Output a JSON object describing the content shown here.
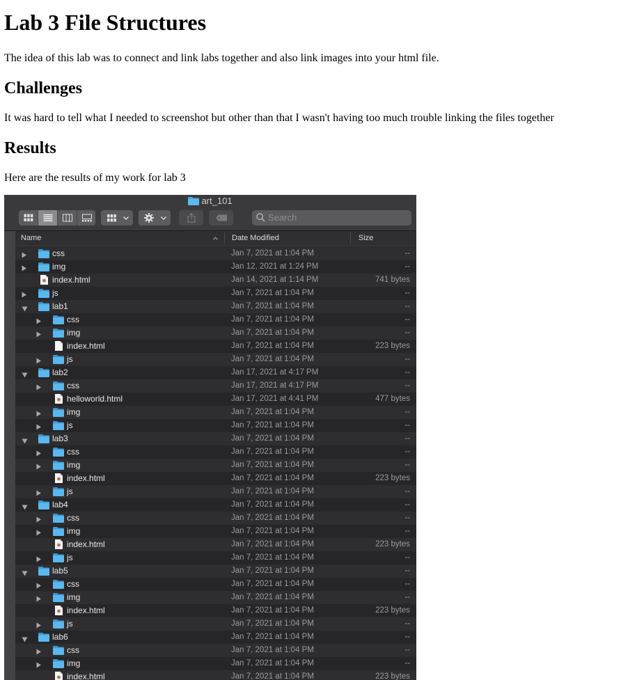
{
  "page": {
    "title": "Lab 3 File Structures",
    "intro": "The idea of this lab was to connect and link labs together and also link images into your html file.",
    "challenges_heading": "Challenges",
    "challenges_text": "It was hard to tell what I needed to screenshot but other than that I wasn't having too much trouble linking the files together",
    "results_heading": "Results",
    "results_text": "Here are the results of my work for lab 3"
  },
  "finder": {
    "window_title": "art_101",
    "search_placeholder": "Search",
    "columns": {
      "name": "Name",
      "date": "Date Modified",
      "size": "Size"
    },
    "colors": {
      "folder": "#4aa8e0",
      "background": "#262626",
      "row_alt": "#2e2e30",
      "text": "#e8e8e8",
      "muted": "#9a9a9a"
    },
    "rows": [
      {
        "name": "css",
        "kind": "folder",
        "depth": 0,
        "expanded": false,
        "date": "Jan 7, 2021 at 1:04 PM",
        "size": "--"
      },
      {
        "name": "img",
        "kind": "folder",
        "depth": 0,
        "expanded": false,
        "date": "Jan 12, 2021 at 1:24 PM",
        "size": "--"
      },
      {
        "name": "index.html",
        "kind": "html",
        "depth": 0,
        "date": "Jan 14, 2021 at 1:14 PM",
        "size": "741 bytes"
      },
      {
        "name": "js",
        "kind": "folder",
        "depth": 0,
        "expanded": false,
        "date": "Jan 7, 2021 at 1:04 PM",
        "size": "--"
      },
      {
        "name": "lab1",
        "kind": "folder",
        "depth": 0,
        "expanded": true,
        "date": "Jan 7, 2021 at 1:04 PM",
        "size": "--"
      },
      {
        "name": "css",
        "kind": "folder",
        "depth": 1,
        "expanded": false,
        "date": "Jan 7, 2021 at 1:04 PM",
        "size": "--"
      },
      {
        "name": "img",
        "kind": "folder",
        "depth": 1,
        "expanded": false,
        "date": "Jan 7, 2021 at 1:04 PM",
        "size": "--"
      },
      {
        "name": "index.html",
        "kind": "file",
        "depth": 1,
        "date": "Jan 7, 2021 at 1:04 PM",
        "size": "223 bytes"
      },
      {
        "name": "js",
        "kind": "folder",
        "depth": 1,
        "expanded": false,
        "date": "Jan 7, 2021 at 1:04 PM",
        "size": "--"
      },
      {
        "name": "lab2",
        "kind": "folder",
        "depth": 0,
        "expanded": true,
        "date": "Jan 17, 2021 at 4:17 PM",
        "size": "--"
      },
      {
        "name": "css",
        "kind": "folder",
        "depth": 1,
        "expanded": false,
        "date": "Jan 17, 2021 at 4:17 PM",
        "size": "--"
      },
      {
        "name": "helloworld.html",
        "kind": "html",
        "depth": 1,
        "date": "Jan 17, 2021 at 4:41 PM",
        "size": "477 bytes"
      },
      {
        "name": "img",
        "kind": "folder",
        "depth": 1,
        "expanded": false,
        "date": "Jan 7, 2021 at 1:04 PM",
        "size": "--"
      },
      {
        "name": "js",
        "kind": "folder",
        "depth": 1,
        "expanded": false,
        "date": "Jan 7, 2021 at 1:04 PM",
        "size": "--"
      },
      {
        "name": "lab3",
        "kind": "folder",
        "depth": 0,
        "expanded": true,
        "date": "Jan 7, 2021 at 1:04 PM",
        "size": "--"
      },
      {
        "name": "css",
        "kind": "folder",
        "depth": 1,
        "expanded": false,
        "date": "Jan 7, 2021 at 1:04 PM",
        "size": "--"
      },
      {
        "name": "img",
        "kind": "folder",
        "depth": 1,
        "expanded": false,
        "date": "Jan 7, 2021 at 1:04 PM",
        "size": "--"
      },
      {
        "name": "index.html",
        "kind": "html",
        "depth": 1,
        "date": "Jan 7, 2021 at 1:04 PM",
        "size": "223 bytes"
      },
      {
        "name": "js",
        "kind": "folder",
        "depth": 1,
        "expanded": false,
        "date": "Jan 7, 2021 at 1:04 PM",
        "size": "--"
      },
      {
        "name": "lab4",
        "kind": "folder",
        "depth": 0,
        "expanded": true,
        "date": "Jan 7, 2021 at 1:04 PM",
        "size": "--"
      },
      {
        "name": "css",
        "kind": "folder",
        "depth": 1,
        "expanded": false,
        "date": "Jan 7, 2021 at 1:04 PM",
        "size": "--"
      },
      {
        "name": "img",
        "kind": "folder",
        "depth": 1,
        "expanded": false,
        "date": "Jan 7, 2021 at 1:04 PM",
        "size": "--"
      },
      {
        "name": "index.html",
        "kind": "html",
        "depth": 1,
        "date": "Jan 7, 2021 at 1:04 PM",
        "size": "223 bytes"
      },
      {
        "name": "js",
        "kind": "folder",
        "depth": 1,
        "expanded": false,
        "date": "Jan 7, 2021 at 1:04 PM",
        "size": "--"
      },
      {
        "name": "lab5",
        "kind": "folder",
        "depth": 0,
        "expanded": true,
        "date": "Jan 7, 2021 at 1:04 PM",
        "size": "--"
      },
      {
        "name": "css",
        "kind": "folder",
        "depth": 1,
        "expanded": false,
        "date": "Jan 7, 2021 at 1:04 PM",
        "size": "--"
      },
      {
        "name": "img",
        "kind": "folder",
        "depth": 1,
        "expanded": false,
        "date": "Jan 7, 2021 at 1:04 PM",
        "size": "--"
      },
      {
        "name": "index.html",
        "kind": "html",
        "depth": 1,
        "date": "Jan 7, 2021 at 1:04 PM",
        "size": "223 bytes"
      },
      {
        "name": "js",
        "kind": "folder",
        "depth": 1,
        "expanded": false,
        "date": "Jan 7, 2021 at 1:04 PM",
        "size": "--"
      },
      {
        "name": "lab6",
        "kind": "folder",
        "depth": 0,
        "expanded": true,
        "date": "Jan 7, 2021 at 1:04 PM",
        "size": "--"
      },
      {
        "name": "css",
        "kind": "folder",
        "depth": 1,
        "expanded": false,
        "date": "Jan 7, 2021 at 1:04 PM",
        "size": "--"
      },
      {
        "name": "img",
        "kind": "folder",
        "depth": 1,
        "expanded": false,
        "date": "Jan 7, 2021 at 1:04 PM",
        "size": "--"
      },
      {
        "name": "index.html",
        "kind": "html",
        "depth": 1,
        "date": "Jan 7, 2021 at 1:04 PM",
        "size": "223 bytes"
      }
    ]
  }
}
